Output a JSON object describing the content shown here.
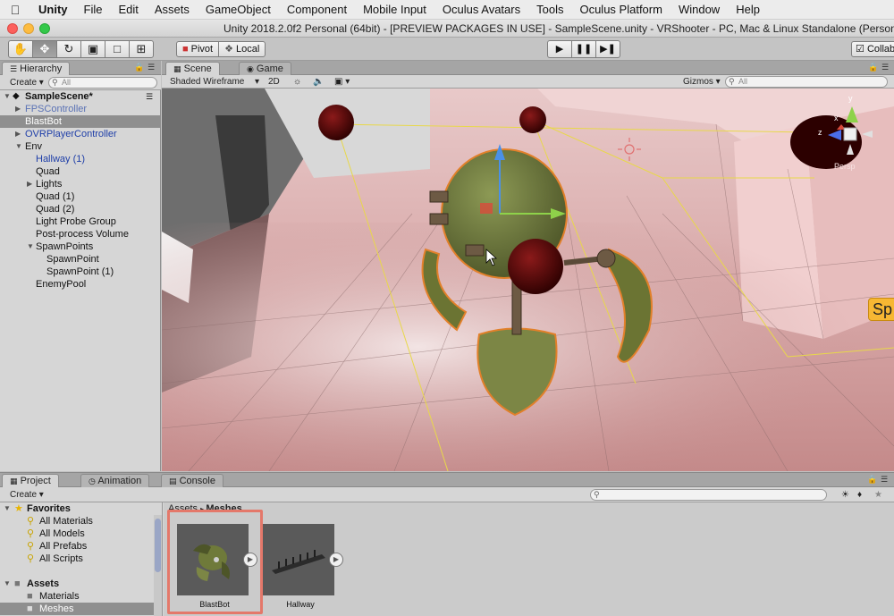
{
  "menubar": {
    "app": "Unity",
    "items": [
      "File",
      "Edit",
      "Assets",
      "GameObject",
      "Component",
      "Mobile Input",
      "Oculus Avatars",
      "Tools",
      "Oculus Platform",
      "Window",
      "Help"
    ]
  },
  "window": {
    "title": "Unity 2018.2.0f2 Personal (64bit) - [PREVIEW PACKAGES IN USE] - SampleScene.unity - VRShooter - PC, Mac & Linux Standalone (Personal)"
  },
  "toolbar": {
    "pivot": "Pivot",
    "local": "Local",
    "collab": "Collab"
  },
  "hierarchy": {
    "tab": "Hierarchy",
    "create": "Create",
    "search_placeholder": "All",
    "scene": "SampleScene*",
    "items": [
      {
        "label": "FPSController",
        "depth": 1,
        "arrow": true,
        "color": "faded"
      },
      {
        "label": "BlastBot",
        "depth": 1,
        "arrow": false,
        "color": "selected"
      },
      {
        "label": "OVRPlayerController",
        "depth": 1,
        "arrow": true,
        "color": "blue"
      },
      {
        "label": "Env",
        "depth": 1,
        "arrow": true,
        "open": true,
        "color": "normal"
      },
      {
        "label": "Hallway (1)",
        "depth": 2,
        "arrow": false,
        "color": "blue"
      },
      {
        "label": "Quad",
        "depth": 2,
        "arrow": false,
        "color": "normal"
      },
      {
        "label": "Lights",
        "depth": 2,
        "arrow": true,
        "color": "normal"
      },
      {
        "label": "Quad (1)",
        "depth": 2,
        "arrow": false,
        "color": "normal"
      },
      {
        "label": "Quad (2)",
        "depth": 2,
        "arrow": false,
        "color": "normal"
      },
      {
        "label": "Light Probe Group",
        "depth": 2,
        "arrow": false,
        "color": "normal"
      },
      {
        "label": "Post-process Volume",
        "depth": 2,
        "arrow": false,
        "color": "normal"
      },
      {
        "label": "SpawnPoints",
        "depth": 2,
        "arrow": true,
        "open": true,
        "color": "normal"
      },
      {
        "label": "SpawnPoint",
        "depth": 3,
        "arrow": false,
        "color": "normal"
      },
      {
        "label": "SpawnPoint (1)",
        "depth": 3,
        "arrow": false,
        "color": "normal"
      },
      {
        "label": "EnemyPool",
        "depth": 2,
        "arrow": false,
        "color": "normal"
      }
    ]
  },
  "scene": {
    "tab_scene": "Scene",
    "tab_game": "Game",
    "draw_mode": "Shaded Wireframe",
    "mode_2d": "2D",
    "gizmos": "Gizmos",
    "search_placeholder": "All",
    "gizmo_axes": {
      "y": "y",
      "x": "x",
      "z": "z"
    },
    "persp": "Persp",
    "edge_label": "Sp"
  },
  "project": {
    "tab_project": "Project",
    "tab_animation": "Animation",
    "tab_console": "Console",
    "create": "Create",
    "favorites_label": "Favorites",
    "favorites": [
      "All Materials",
      "All Models",
      "All Prefabs",
      "All Scripts"
    ],
    "assets_label": "Assets",
    "asset_folders": [
      "Materials",
      "Meshes"
    ],
    "breadcrumb_root": "Assets",
    "breadcrumb_current": "Meshes",
    "files": [
      "BlastBot",
      "Hallway"
    ]
  },
  "colors": {
    "selection": "#8f8f8f",
    "highlight_box": "#e4786a",
    "prefab_blue": "#1e3ea8"
  }
}
